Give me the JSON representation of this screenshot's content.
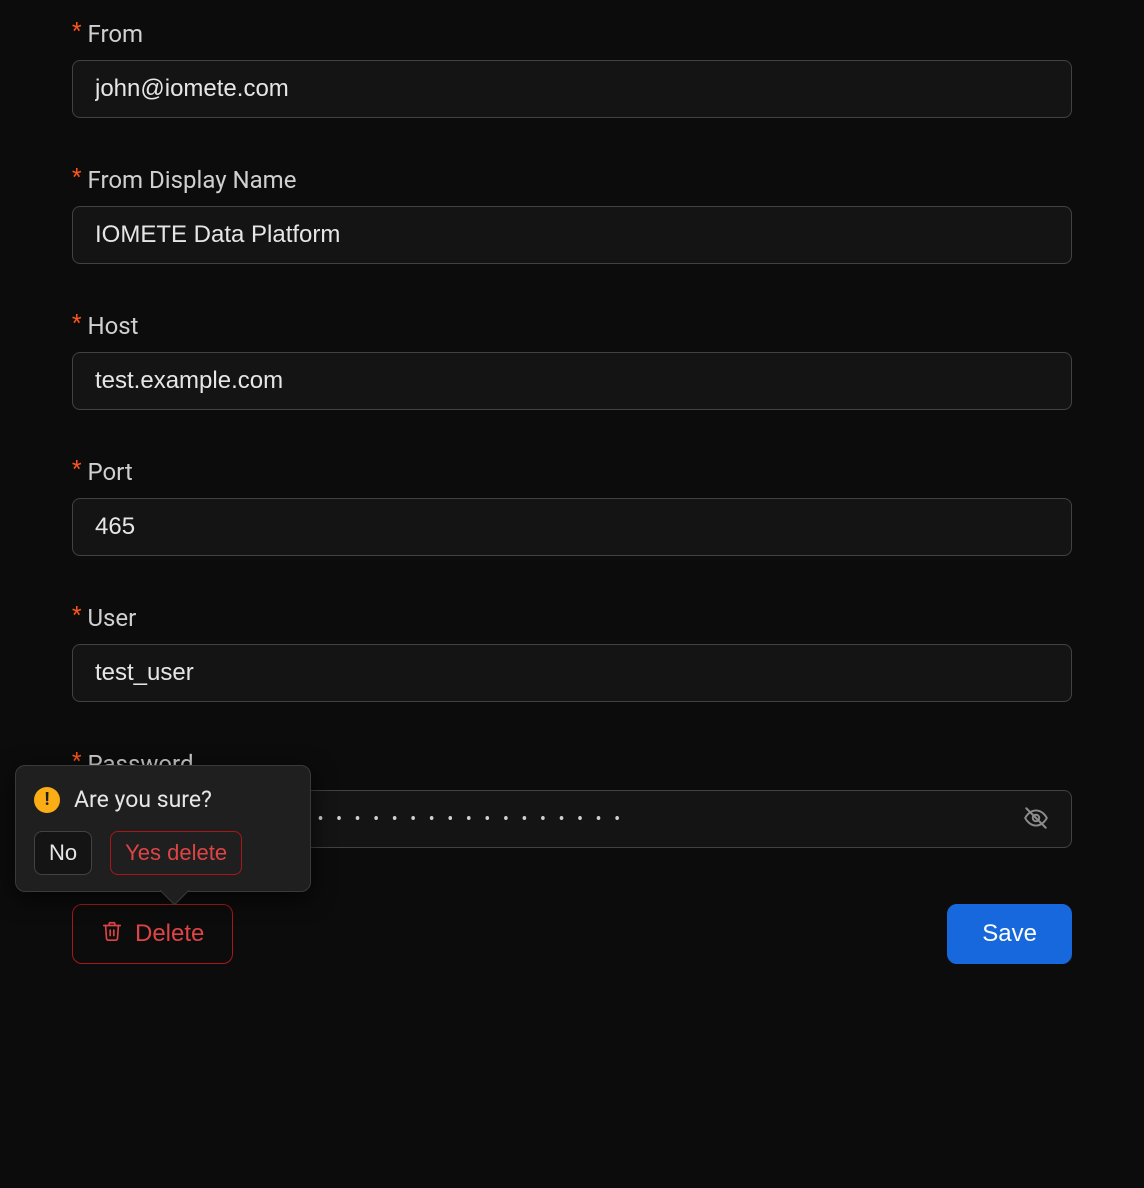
{
  "fields": {
    "from": {
      "label": "From",
      "value": "john@iomete.com"
    },
    "from_display_name": {
      "label": "From Display Name",
      "value": "IOMETE Data Platform"
    },
    "host": {
      "label": "Host",
      "value": "test.example.com"
    },
    "port": {
      "label": "Port",
      "value": "465"
    },
    "user": {
      "label": "User",
      "value": "test_user"
    },
    "password": {
      "label": "Password",
      "masked": "•  •  •  •  •  •  •  •  •  •  •  •  •  •  •  •  •  •  •  •  •  •  •  •  •  •  •  •  •"
    }
  },
  "required_marker": "*",
  "footer": {
    "delete_label": "Delete",
    "save_label": "Save"
  },
  "popover": {
    "title": "Are you sure?",
    "no_label": "No",
    "yes_label": "Yes delete"
  }
}
